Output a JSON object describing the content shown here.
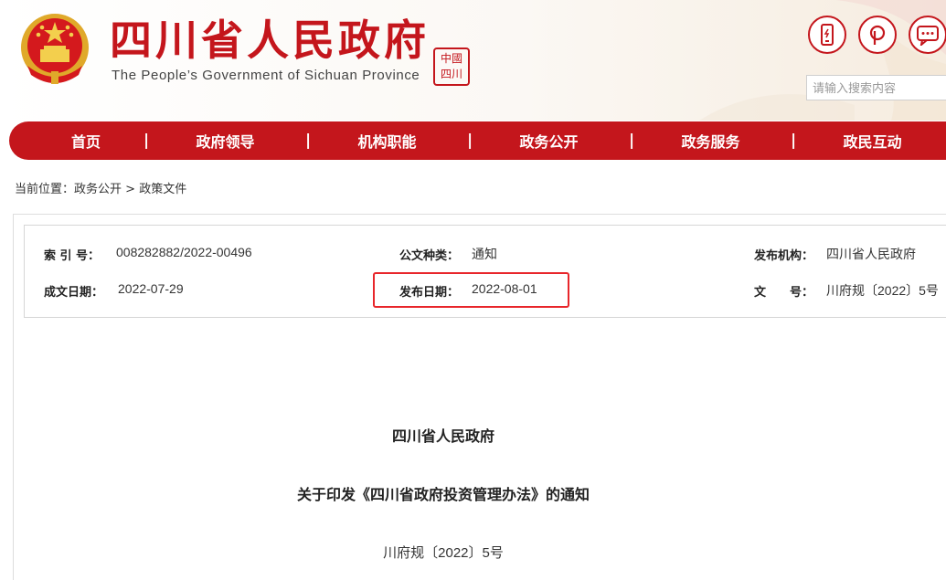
{
  "header": {
    "title": "四川省人民政府",
    "subtitle": "The People’s Government of Sichuan Province",
    "seal_text": [
      "中",
      "國",
      "四",
      "川"
    ],
    "icons": [
      "mobile-icon",
      "weibo-icon",
      "wechat-icon"
    ],
    "search_placeholder": "请输入搜索内容"
  },
  "nav": {
    "items": [
      "首页",
      "政府领导",
      "机构职能",
      "政务公开",
      "政务服务",
      "政民互动"
    ],
    "separator": "|"
  },
  "breadcrumb": {
    "prefix": "当前位置：",
    "level1": "政务公开",
    "arrow": ">",
    "level2": "政策文件"
  },
  "meta": {
    "index_label": "索 引 号：",
    "index_value": "008282882/2022-00496",
    "type_label": "公文种类：",
    "type_value": "通知",
    "org_label": "发布机构：",
    "org_value": "四川省人民政府",
    "created_label": "成文日期：",
    "created_value": "2022-07-29",
    "published_label": "发布日期：",
    "published_value": "2022-08-01",
    "docno_label": "文　　号：",
    "docno_value": "川府规〔2022〕5号"
  },
  "document": {
    "issuer": "四川省人民政府",
    "title": "关于印发《四川省政府投资管理办法》的通知",
    "number": "川府规〔2022〕5号"
  },
  "colors": {
    "brand_red": "#c4161c",
    "highlight_red": "#e8262b"
  }
}
